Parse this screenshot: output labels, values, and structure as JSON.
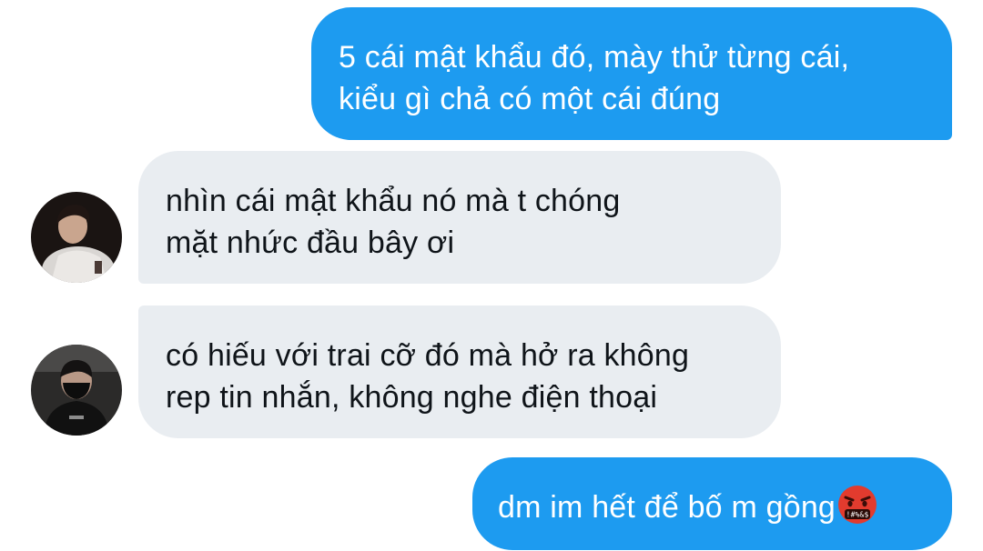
{
  "conversation": {
    "messages": [
      {
        "direction": "outgoing",
        "lines": [
          "5 cái mật khẩu đó, mày thử từng cái,",
          "kiểu gì chả có một cái đúng"
        ]
      },
      {
        "direction": "incoming",
        "avatar_icon": "user-photo-avatar",
        "lines": [
          "nhìn cái mật khẩu nó mà t chóng",
          "mặt nhức đầu bây ơi"
        ]
      },
      {
        "direction": "incoming",
        "avatar_icon": "user-photo-avatar-masked",
        "lines": [
          "có hiếu với trai cỡ đó mà hở ra không",
          "rep tin nhắn, không nghe điện thoại"
        ]
      },
      {
        "direction": "outgoing",
        "lines": [
          "dm im hết để bố m gồng"
        ],
        "trailing_emoji": "face-with-symbols-on-mouth"
      }
    ]
  },
  "colors": {
    "outgoing_bubble": "#1d9bf0",
    "incoming_bubble": "#e9edf1",
    "incoming_text": "#0f1419",
    "outgoing_text": "#ffffff"
  }
}
